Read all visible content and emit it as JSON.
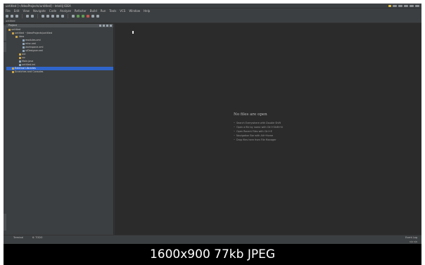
{
  "window": {
    "title": "untitled [~/IdeaProjects/untitled] - IntelliJ IDEA"
  },
  "menu": [
    "File",
    "Edit",
    "View",
    "Navigate",
    "Code",
    "Analyze",
    "Refactor",
    "Build",
    "Run",
    "Tools",
    "VCS",
    "Window",
    "Help"
  ],
  "breadcrumb": "untitled",
  "project_panel": {
    "title": "Project",
    "tree": [
      {
        "label": "untitled",
        "indent": 0,
        "type": "folder"
      },
      {
        "label": "untitled  ~/IdeaProjects/untitled",
        "indent": 1,
        "type": "folder"
      },
      {
        "label": ".idea",
        "indent": 2,
        "type": "folder"
      },
      {
        "label": "modules.xml",
        "indent": 4,
        "type": "file"
      },
      {
        "label": "misc.xml",
        "indent": 4,
        "type": "file"
      },
      {
        "label": "workspace.xml",
        "indent": 4,
        "type": "file"
      },
      {
        "label": "uiDesigner.xml",
        "indent": 4,
        "type": "file"
      },
      {
        "label": "out",
        "indent": 3,
        "type": "folder"
      },
      {
        "label": "src",
        "indent": 3,
        "type": "folder"
      },
      {
        "label": "Main.java",
        "indent": 3,
        "type": "file"
      },
      {
        "label": "untitled.iml",
        "indent": 3,
        "type": "file"
      },
      {
        "label": "External Libraries",
        "indent": 1,
        "type": "folder",
        "selected": true
      },
      {
        "label": "Scratches and Consoles",
        "indent": 1,
        "type": "folder"
      }
    ]
  },
  "editor": {
    "empty_title": "No files are open",
    "hints": [
      "Search Everywhere with Double Shift",
      "Open a file by name with Ctrl+Shift+N",
      "Open Recent Files with Ctrl+E",
      "Navigation Bar with Alt+Home",
      "Drop files here from File Manager"
    ]
  },
  "bottom_bar": {
    "terminal": "Terminal",
    "todo": "6: TODO",
    "event_log": "Event Log"
  },
  "status_bar": {
    "right": "n/a   n/a"
  },
  "caption": "1600x900 77kb JPEG"
}
